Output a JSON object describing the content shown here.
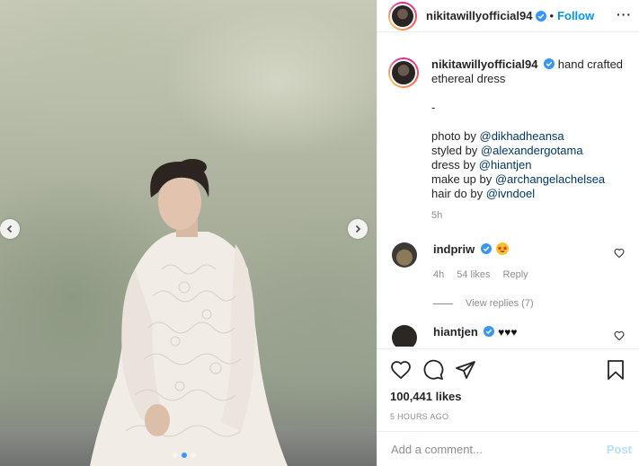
{
  "post": {
    "author": "nikitawillyofficial94",
    "follow_label": "Follow",
    "separator": "•",
    "more_label": "···",
    "caption": {
      "text": "hand crafted ethereal dress",
      "dash": "-",
      "credits": [
        {
          "prefix": "photo by ",
          "handle": "@dikhadheansa"
        },
        {
          "prefix": "styled by ",
          "handle": "@alexandergotama"
        },
        {
          "prefix": "dress by ",
          "handle": "@hiantjen"
        },
        {
          "prefix": "make up by ",
          "handle": "@archangelachelsea"
        },
        {
          "prefix": "hair do by ",
          "handle": "@ivndoel"
        }
      ],
      "time": "5h"
    },
    "comments": [
      {
        "user": "indpriw",
        "text": "",
        "emoji": "star-struck",
        "time": "4h",
        "likes": "54 likes",
        "reply_label": "Reply",
        "view_replies": "View replies (7)"
      },
      {
        "user": "hiantjen",
        "text": "",
        "emoji": "black-hearts x3"
      }
    ],
    "likes_count": "100,441 likes",
    "posted_ago": "5 HOURS AGO",
    "comment_placeholder": "Add a comment...",
    "post_label": "Post",
    "carousel": {
      "count": 3,
      "active": 1
    }
  },
  "colors": {
    "link": "#0095f6",
    "mention": "#00376b",
    "muted": "#8e8e8e",
    "post_disabled": "#b2dffc"
  },
  "icons": [
    "chevron-left-icon",
    "chevron-right-icon",
    "verified-badge-icon",
    "more-icon",
    "heart-icon",
    "comment-icon",
    "share-icon",
    "bookmark-icon"
  ]
}
